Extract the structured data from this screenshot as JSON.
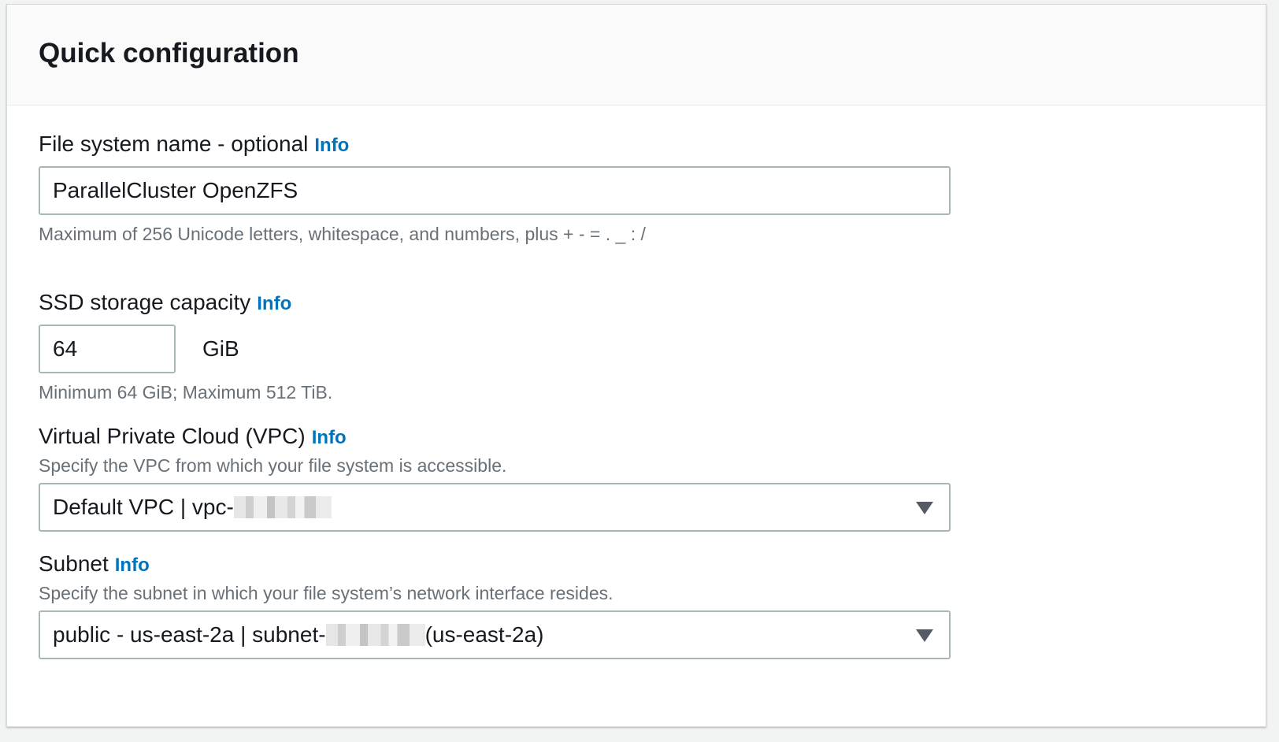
{
  "panel": {
    "title": "Quick configuration"
  },
  "fields": {
    "file_system_name": {
      "label": "File system name - optional",
      "info": "Info",
      "value": "ParallelCluster OpenZFS",
      "hint": "Maximum of 256 Unicode letters, whitespace, and numbers, plus + - = . _ : /"
    },
    "storage_capacity": {
      "label": "SSD storage capacity",
      "info": "Info",
      "value": "64",
      "unit": "GiB",
      "hint": "Minimum 64 GiB; Maximum 512 TiB."
    },
    "vpc": {
      "label": "Virtual Private Cloud (VPC)",
      "info": "Info",
      "description": "Specify the VPC from which your file system is accessible.",
      "selected_prefix": "Default VPC | vpc-",
      "selected_suffix": ""
    },
    "subnet": {
      "label": "Subnet",
      "info": "Info",
      "description": "Specify the subnet in which your file system’s network interface resides.",
      "selected_prefix": "public - us-east-2a | subnet-",
      "selected_suffix": "(us-east-2a)"
    }
  },
  "icons": {
    "dropdown": "caret-down-icon"
  },
  "colors": {
    "link": "#0073bb",
    "hint": "#687078",
    "border": "#aab7b8"
  }
}
